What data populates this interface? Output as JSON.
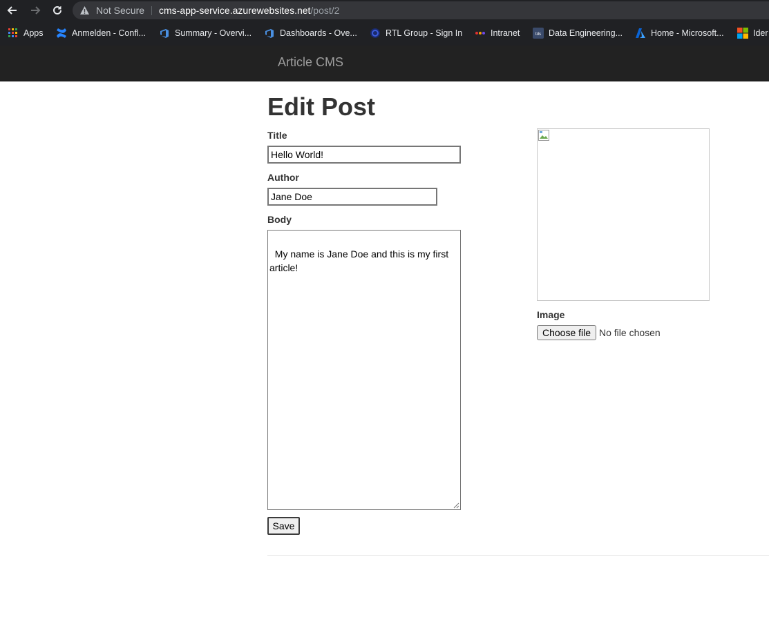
{
  "browser": {
    "security_label": "Not Secure",
    "url_host": "cms-app-service.azurewebsites.net",
    "url_path": "/post/2"
  },
  "bookmarks": [
    {
      "label": "Apps",
      "icon": "apps-grid-icon"
    },
    {
      "label": "Anmelden - Confl...",
      "icon": "confluence-icon"
    },
    {
      "label": "Summary - Overvi...",
      "icon": "azure-devops-icon"
    },
    {
      "label": "Dashboards - Ove...",
      "icon": "azure-devops-icon"
    },
    {
      "label": "RTL Group - Sign In",
      "icon": "rtl-icon"
    },
    {
      "label": "Intranet",
      "icon": "intranet-icon"
    },
    {
      "label": "Data Engineering...",
      "icon": "tds-icon"
    },
    {
      "label": "Home - Microsoft...",
      "icon": "azure-icon"
    },
    {
      "label": "Ider",
      "icon": "microsoft-icon"
    }
  ],
  "navbar": {
    "brand": "Article CMS"
  },
  "form": {
    "heading": "Edit Post",
    "title_label": "Title",
    "title_value": "Hello World!",
    "author_label": "Author",
    "author_value": "Jane Doe",
    "body_label": "Body",
    "body_value": "My name is Jane Doe and this is my first article!",
    "save_label": "Save",
    "image_label": "Image",
    "choose_file_label": "Choose file",
    "file_status": "No file chosen"
  }
}
